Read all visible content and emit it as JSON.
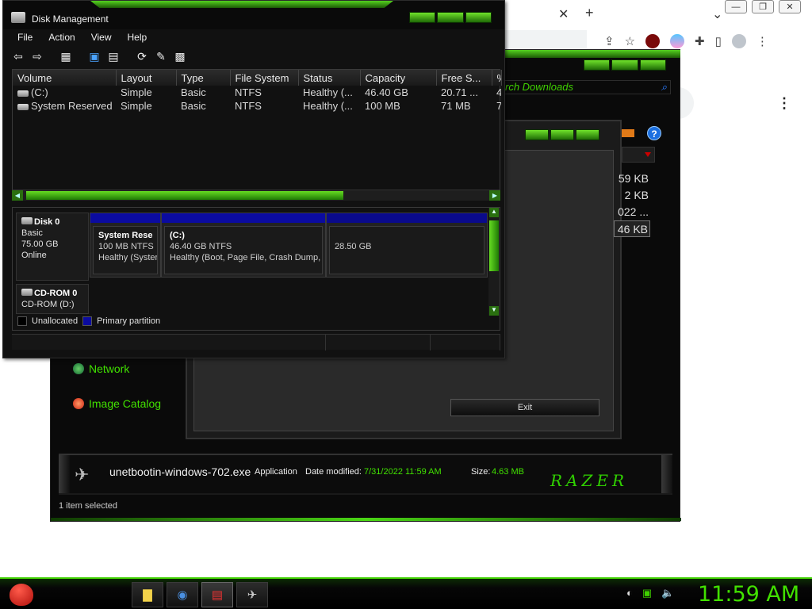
{
  "browser": {
    "new_tab_icon": "plus-icon",
    "close_tab_icon": "close-icon",
    "tab_search_icon": "chevron-down-icon",
    "toolbar_icons": [
      "share-icon",
      "star-icon",
      "ublock-icon",
      "extension-icon",
      "puzzle-icon",
      "sidebar-icon",
      "profile-icon",
      "kebab-menu-icon"
    ]
  },
  "explorer": {
    "search_placeholder": "rch Downloads",
    "sizes": [
      "59 KB",
      "2 KB",
      "022 ...",
      "46 KB"
    ],
    "nav": [
      {
        "label": "Network",
        "icon": "globe-icon",
        "color": "#2e8b2e"
      },
      {
        "label": "Image Catalog",
        "icon": "image-catalog-icon",
        "color": "#e04a2a"
      }
    ],
    "exit_label": "Exit",
    "details": {
      "file_name": "unetbootin-windows-702.exe",
      "file_type": "Application",
      "date_label": "Date modified:",
      "date_value": "7/31/2022 11:59 AM",
      "size_label": "Size:",
      "size_value": "4.63 MB",
      "logo_text": "RAZER"
    },
    "status": "1 item selected"
  },
  "disk_management": {
    "title": "Disk Management",
    "menu": [
      "File",
      "Action",
      "View",
      "Help"
    ],
    "columns": [
      "Volume",
      "Layout",
      "Type",
      "File System",
      "Status",
      "Capacity",
      "Free S...",
      "%"
    ],
    "volumes": [
      {
        "volume": "(C:)",
        "layout": "Simple",
        "type": "Basic",
        "fs": "NTFS",
        "status": "Healthy (...",
        "capacity": "46.40 GB",
        "free": "20.71 ...",
        "pct": "4"
      },
      {
        "volume": "System Reserved",
        "layout": "Simple",
        "type": "Basic",
        "fs": "NTFS",
        "status": "Healthy (...",
        "capacity": "100 MB",
        "free": "71 MB",
        "pct": "7"
      }
    ],
    "disk0": {
      "name": "Disk 0",
      "type": "Basic",
      "size": "75.00 GB",
      "state": "Online",
      "partitions": [
        {
          "name": "System Rese",
          "size": "100 MB NTFS",
          "status": "Healthy (Syster"
        },
        {
          "name": "(C:)",
          "size": "46.40 GB NTFS",
          "status": "Healthy (Boot, Page File, Crash Dump, Pr"
        },
        {
          "name": "",
          "size": "28.50 GB",
          "status": ""
        }
      ]
    },
    "cdrom0": {
      "name": "CD-ROM 0",
      "drive": "CD-ROM (D:)"
    },
    "legend": [
      {
        "label": "Unallocated",
        "color": "#000000"
      },
      {
        "label": "Primary partition",
        "color": "#0b0ba0"
      }
    ]
  },
  "taskbar": {
    "apps": [
      "file-manager-icon",
      "chrome-icon",
      "disk-management-icon",
      "unetbootin-icon"
    ],
    "tray": [
      "network-icon",
      "battery-icon",
      "volume-icon"
    ],
    "clock": "11:59 AM"
  },
  "colors": {
    "accent_green": "#41e000",
    "primary_partition": "#0b0ba0"
  }
}
